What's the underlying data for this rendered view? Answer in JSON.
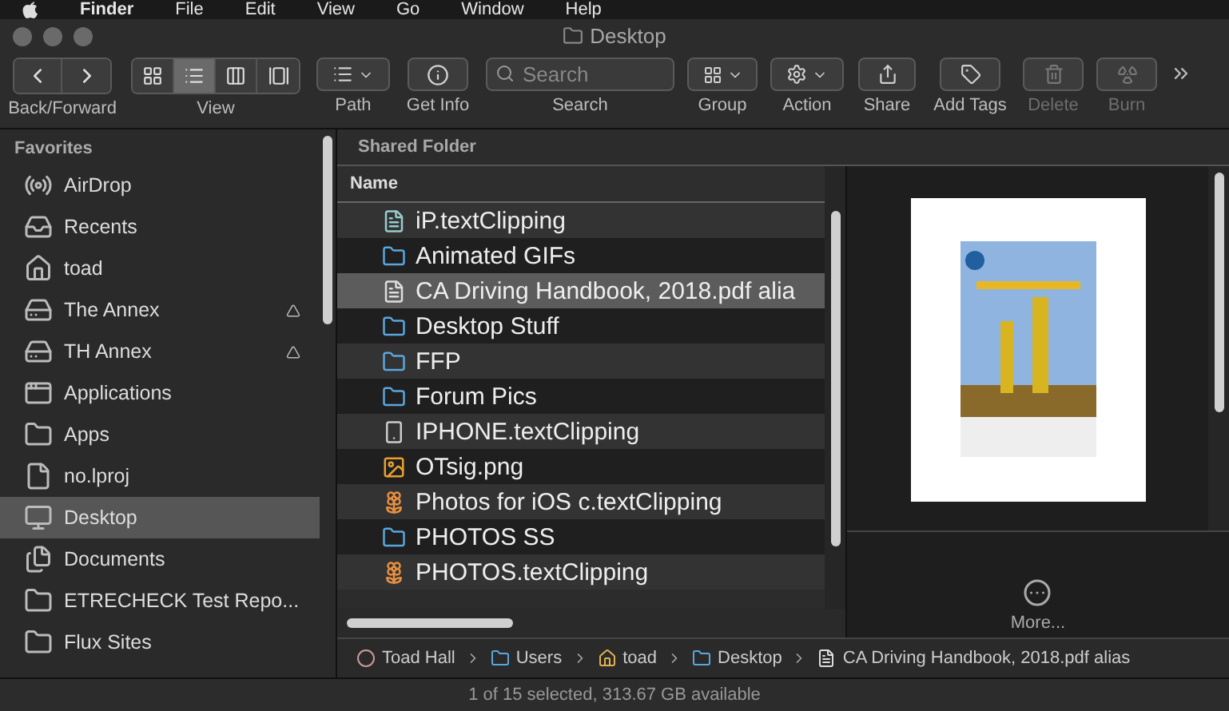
{
  "menu_bar": [
    "Finder",
    "File",
    "Edit",
    "View",
    "Go",
    "Window",
    "Help"
  ],
  "window": {
    "title": "Desktop"
  },
  "toolbar": [
    {
      "kind": "nav",
      "label": "Back/Forward",
      "disabled": false
    },
    {
      "kind": "view",
      "label": "View",
      "disabled": false,
      "segments": [
        {
          "selected": false
        },
        {
          "selected": true
        },
        {
          "selected": false
        },
        {
          "selected": false
        }
      ]
    },
    {
      "kind": "path",
      "label": "Path",
      "disabled": false
    },
    {
      "kind": "info",
      "label": "Get Info",
      "disabled": false
    },
    {
      "kind": "search",
      "label": "Search",
      "placeholder": "Search",
      "disabled": false
    },
    {
      "kind": "group",
      "label": "Group",
      "disabled": false
    },
    {
      "kind": "action",
      "label": "Action",
      "disabled": false
    },
    {
      "kind": "share",
      "label": "Share",
      "disabled": false
    },
    {
      "kind": "tags",
      "label": "Add Tags",
      "disabled": false
    },
    {
      "kind": "delete",
      "label": "Delete",
      "disabled": true
    },
    {
      "kind": "burn",
      "label": "Burn",
      "disabled": true
    }
  ],
  "sidebar": {
    "heading": "Favorites",
    "items": [
      {
        "kind": "airdrop",
        "label": "AirDrop",
        "eject": false,
        "selected": false
      },
      {
        "kind": "recents",
        "label": "Recents",
        "eject": false,
        "selected": false
      },
      {
        "kind": "home",
        "label": "toad",
        "eject": false,
        "selected": false
      },
      {
        "kind": "drive",
        "label": "The Annex",
        "eject": true,
        "selected": false
      },
      {
        "kind": "drive",
        "label": "TH Annex",
        "eject": true,
        "selected": false
      },
      {
        "kind": "apps",
        "label": "Applications",
        "eject": false,
        "selected": false
      },
      {
        "kind": "folder",
        "label": "Apps",
        "eject": false,
        "selected": false
      },
      {
        "kind": "file",
        "label": "no.lproj",
        "eject": false,
        "selected": false
      },
      {
        "kind": "desktop",
        "label": "Desktop",
        "eject": false,
        "selected": true
      },
      {
        "kind": "documents",
        "label": "Documents",
        "eject": false,
        "selected": false
      },
      {
        "kind": "folder",
        "label": "ETRECHECK Test Repo...",
        "eject": false,
        "selected": false
      },
      {
        "kind": "folder",
        "label": "Flux Sites",
        "eject": false,
        "selected": false
      }
    ]
  },
  "file_list": {
    "header": "Shared Folder",
    "column": "Name",
    "rows": [
      {
        "kind": "clipping",
        "name": "iP.textClipping",
        "selected": false
      },
      {
        "kind": "folder",
        "name": "Animated GIFs",
        "selected": false
      },
      {
        "kind": "pdf",
        "name": "CA Driving Handbook, 2018.pdf alia",
        "selected": true
      },
      {
        "kind": "folder",
        "name": "Desktop Stuff",
        "selected": false
      },
      {
        "kind": "folder",
        "name": "FFP",
        "selected": false
      },
      {
        "kind": "folder",
        "name": "Forum Pics",
        "selected": false
      },
      {
        "kind": "phone",
        "name": "IPHONE.textClipping",
        "selected": false
      },
      {
        "kind": "image",
        "name": "OTsig.png",
        "selected": false
      },
      {
        "kind": "photos",
        "name": "Photos for iOS c.textClipping",
        "selected": false
      },
      {
        "kind": "folder",
        "name": "PHOTOS SS",
        "selected": false
      },
      {
        "kind": "photos",
        "name": "PHOTOS.textClipping",
        "selected": false
      }
    ]
  },
  "preview": {
    "more": "More..."
  },
  "path_bar": [
    {
      "kind": "disk",
      "label": "Toad Hall"
    },
    {
      "kind": "folder",
      "label": "Users"
    },
    {
      "kind": "home",
      "label": "toad"
    },
    {
      "kind": "folder",
      "label": "Desktop"
    },
    {
      "kind": "pdf",
      "label": "CA Driving Handbook, 2018.pdf alias"
    }
  ],
  "status_bar": "1 of 15 selected, 313.67 GB available"
}
